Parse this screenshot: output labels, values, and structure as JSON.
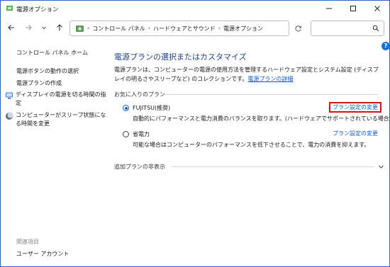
{
  "window": {
    "title": "電源オプション"
  },
  "address": {
    "crumbs": [
      "コントロール パネル",
      "ハードウェアとサウンド",
      "電源オプション"
    ]
  },
  "search": {
    "placeholder": ""
  },
  "left_pane": {
    "home": "コントロール パネル ホーム",
    "links": [
      "電源ボタンの動作の選択",
      "電源プランの作成"
    ],
    "items": [
      {
        "icon": "monitor-icon",
        "label": "ディスプレイの電源を切る時間の指定"
      },
      {
        "icon": "moon-icon",
        "label": "コンピューターがスリープ状態になる時間を変更"
      }
    ],
    "related_header": "関連項目",
    "related": [
      "ユーザー アカウント"
    ]
  },
  "main": {
    "title": "電源プランの選択またはカスタマイズ",
    "desc": "電源プランは、コンピューターの電源の使用方法を管理するハードウェア設定とシステム設定 (ディスプレイの明るさやスリープなど) のコレクションです。",
    "desc_link": "電源プランの詳細",
    "favorites_label": "お気に入りのプラン",
    "plans": [
      {
        "name": "FUJITSU(推奨)",
        "selected": true,
        "link": "プラン設定の変更",
        "desc": "自動的にパフォーマンスと電力消費のバランスを取ります。(ハードウェアでサポートされている場合)"
      },
      {
        "name": "省電力",
        "selected": false,
        "link": "プラン設定の変更",
        "desc": "可能な場合はコンピューターのパフォーマンスを低下させることで、電力の消費を抑えます。"
      }
    ],
    "extra_plans_label": "追加プランの非表示",
    "help": "?"
  },
  "colors": {
    "accent": "#1a60c8",
    "link": "#0a5bd3",
    "highlight_box": "#e01010",
    "title": "#1d3f8f"
  }
}
